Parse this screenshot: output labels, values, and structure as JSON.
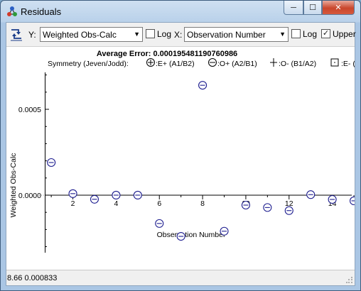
{
  "window": {
    "title": "Residuals"
  },
  "toolbar": {
    "y_label": "Y:",
    "y_select": "Weighted Obs-Calc",
    "y_log_label": "Log",
    "y_log_checked": false,
    "x_label": "X:",
    "x_select": "Observation Number",
    "x_log_label": "Log",
    "x_log_checked": false,
    "upper_label": "Upper",
    "upper_checked": true
  },
  "plot": {
    "header": "Average Error: 0.000195481190760986",
    "legend": {
      "prefix": "Symmetry (Jeven/Jodd):",
      "items": [
        {
          "symbol": "circle-plus",
          "label": ":E+ (A1/B2)"
        },
        {
          "symbol": "circle-minus",
          "label": ":O+ (A2/B1)"
        },
        {
          "symbol": "plus",
          "label": ":O- (B1/A2)"
        },
        {
          "symbol": "square-dot",
          "label": ":E- ("
        }
      ]
    }
  },
  "chart_data": {
    "type": "scatter",
    "title": "Average Error: 0.000195481190760986",
    "xlabel": "Observation Number",
    "ylabel": "Weighted Obs-Calc",
    "x_ticks": [
      2,
      4,
      6,
      8,
      10,
      12,
      14
    ],
    "y_ticks": [
      {
        "value": 0,
        "label": "0.0000"
      },
      {
        "value": 0.0005,
        "label": "0.0005"
      }
    ],
    "xlim": [
      0.7,
      14.9
    ],
    "ylim": [
      -0.000335,
      0.000715
    ],
    "series": [
      {
        "name": ":O+ (A2/B1)",
        "marker": "circle-minus",
        "points": [
          {
            "x": 1,
            "y": 0.00019
          },
          {
            "x": 2,
            "y": 8.8e-06
          },
          {
            "x": 3,
            "y": -2.4e-05
          },
          {
            "x": 4,
            "y": 0.0
          },
          {
            "x": 5,
            "y": 0.0
          },
          {
            "x": 6,
            "y": -0.000165
          },
          {
            "x": 7,
            "y": -0.00024
          },
          {
            "x": 8,
            "y": 0.00064
          },
          {
            "x": 9,
            "y": -0.00021
          },
          {
            "x": 10,
            "y": -5.8e-05
          },
          {
            "x": 11,
            "y": -7.2e-05
          },
          {
            "x": 12,
            "y": -9e-05
          },
          {
            "x": 13,
            "y": 3e-06
          },
          {
            "x": 14,
            "y": -2.5e-05
          },
          {
            "x": 15,
            "y": -3.3e-05
          }
        ]
      }
    ]
  },
  "status": {
    "text": "8.66  0.000833"
  },
  "colors": {
    "marker": "#1d1d8f",
    "axis": "#000000",
    "dotted_guide": "#9a9a9a"
  },
  "icons": {
    "app": "molecule-icon",
    "swap": "swap-axes-icon",
    "minimize": "minimize-icon",
    "maximize": "maximize-icon",
    "close": "close-icon"
  }
}
